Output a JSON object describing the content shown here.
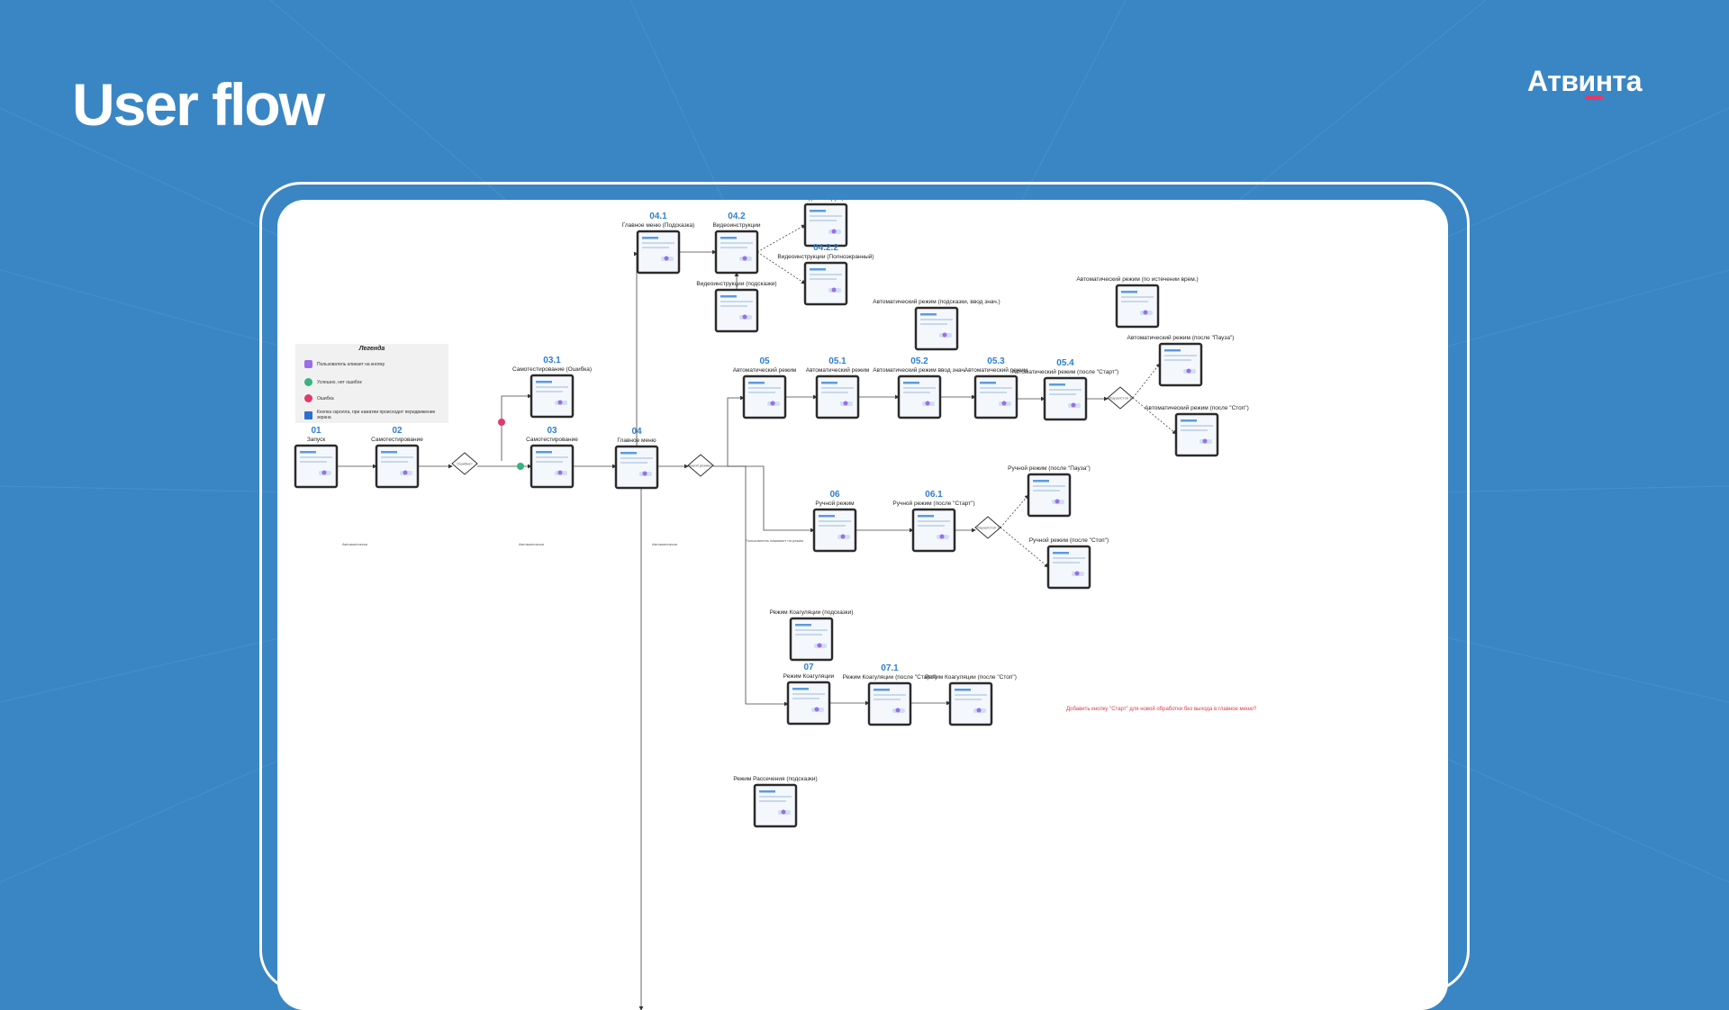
{
  "header": {
    "title": "User flow",
    "brand": "Атвинта"
  },
  "legend": {
    "title": "Легенда",
    "items": [
      {
        "text": "Пользователь кликает на кнопку",
        "color": "#9b6ee8"
      },
      {
        "text": "Успешно, нет ошибок",
        "color": "#36b37e"
      },
      {
        "text": "Ошибка",
        "color": "#e23a6a"
      },
      {
        "text": "Кнопка скролла, при нажатии происходит передвижение экрана",
        "color": "#2f6fd0"
      }
    ]
  },
  "screens": {
    "s01": {
      "num": "01",
      "title": "Запуск"
    },
    "s02": {
      "num": "02",
      "title": "Самотестирование"
    },
    "s03": {
      "num": "03",
      "title": "Самотестирование"
    },
    "s031": {
      "num": "03.1",
      "title": "Самотестирование (Ошибка)"
    },
    "s04": {
      "num": "04",
      "title": "Главное меню"
    },
    "s041": {
      "num": "04.1",
      "title": "Главное меню (Подсказка)"
    },
    "s042": {
      "num": "04.2",
      "title": "Видеоинструкции"
    },
    "s0421": {
      "num": "04.2.1",
      "title": "Видеоинструкции"
    },
    "s0422": {
      "num": "04.2.2",
      "title": "Видеоинструкции (Полноэкранный)"
    },
    "s042b": {
      "num": "",
      "title": "Видеоинструкции (подсказки)"
    },
    "s05": {
      "num": "05",
      "title": "Автоматический режим"
    },
    "s051": {
      "num": "05.1",
      "title": "Автоматический режим"
    },
    "s052": {
      "num": "05.2",
      "title": "Автоматический режим ввод знач."
    },
    "s052b": {
      "num": "",
      "title": "Автоматический режим (подсказки, ввод знач.)"
    },
    "s053": {
      "num": "05.3",
      "title": "Автоматический режим"
    },
    "s054": {
      "num": "05.4",
      "title": "Автоматический режим (после \"Старт\")"
    },
    "s05p": {
      "num": "",
      "title": "Автоматический режим (после \"Пауза\")"
    },
    "s05e": {
      "num": "",
      "title": "Автоматический режим (по истечении врем.)"
    },
    "s05s": {
      "num": "",
      "title": "Автоматический режим (после \"Стоп\")"
    },
    "s06": {
      "num": "06",
      "title": "Ручной режим"
    },
    "s061": {
      "num": "06.1",
      "title": "Ручной режим (после \"Старт\")"
    },
    "s06p": {
      "num": "",
      "title": "Ручной режим (после \"Пауза\")"
    },
    "s06s": {
      "num": "",
      "title": "Ручной режим (после \"Стоп\")"
    },
    "s07h": {
      "num": "",
      "title": "Режим Коагуляции (подсказки)"
    },
    "s07": {
      "num": "07",
      "title": "Режим Коагуляции"
    },
    "s071": {
      "num": "07.1",
      "title": "Режим Коагуляции (после \"Старт\")"
    },
    "s07s": {
      "num": "",
      "title": "Режим Коагуляции (после \"Стоп\")"
    },
    "s08h": {
      "num": "",
      "title": "Режим Рассечения (подсказки)"
    }
  },
  "decisions": {
    "d1": "Ошибка?",
    "d2": "Какой режим?",
    "d3": "Пауза/Стоп ?",
    "d4": "Пауза/Стоп ?"
  },
  "edges": {
    "e1": "Автоматически",
    "e2": "Автоматически",
    "e3": "Автоматически",
    "e4": "Пользователь нажимает на режим"
  },
  "notes": {
    "red_note": "Добавить кнопку \"Старт\" для новой обработки без выхода в главное меню?"
  },
  "colors": {
    "background": "#3a86c4",
    "accent": "#2f7fd0",
    "brand_underline": "#e23a6a"
  }
}
